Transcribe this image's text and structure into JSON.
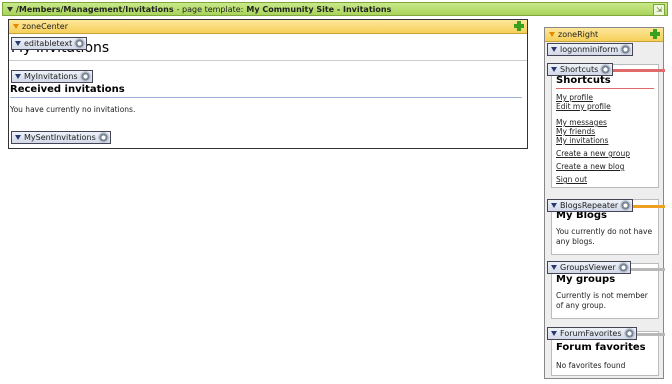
{
  "header": {
    "path": "/Members/Management/Invitations",
    "template_label": "- page template:",
    "template_name": "My Community Site - Invitations",
    "expand_icon": "expand-icon"
  },
  "zone_center": {
    "label": "zoneCenter",
    "webparts": {
      "editabletext": "editabletext",
      "myinvitations": "MyInvitations",
      "mysentinvitations": "MySentInvitations"
    },
    "page_title": "My Invitations",
    "received_heading": "Received invitations",
    "no_invitations_text": "You have currently no invitations."
  },
  "zone_right": {
    "label": "zoneRight",
    "webparts": {
      "logon": "logonminiform",
      "shortcuts": "Shortcuts",
      "blogs": "BlogsRepeater",
      "groups": "GroupsViewer",
      "forum": "ForumFavorites"
    },
    "shortcuts": {
      "title": "Shortcuts",
      "links": [
        "My profile",
        "Edit my profile",
        "My messages",
        "My friends",
        "My invitations",
        "Create a new group",
        "Create a new blog",
        "Sign out"
      ]
    },
    "blogs": {
      "title": "My Blogs",
      "text": "You currently do not have any blogs."
    },
    "groups": {
      "title": "My groups",
      "text": "Currently is not member of any group."
    },
    "forum": {
      "title": "Forum favorites",
      "text": "No favorites found"
    }
  },
  "colors": {
    "top_bar": "#b4dc6e",
    "zone_header": "#f8d66a",
    "webpart_header": "#dfe4ef",
    "shortcuts_bar": "#e06a6a",
    "blogs_bar": "#f0a020",
    "groups_bar": "#b8b8b8",
    "forum_bar": "#b8b8b8",
    "add_button": "#3aa01e"
  }
}
